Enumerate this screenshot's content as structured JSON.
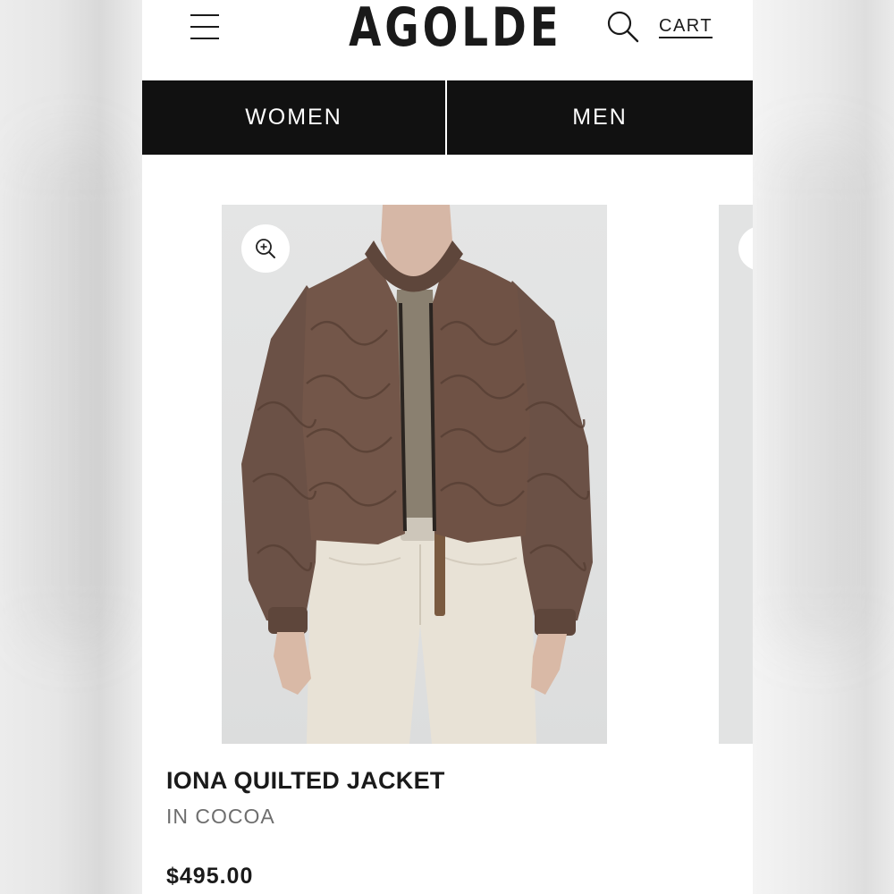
{
  "header": {
    "logo": "AGOLDE",
    "cart_label": "CART"
  },
  "nav": {
    "tabs": [
      {
        "label": "WOMEN"
      },
      {
        "label": "MEN"
      }
    ]
  },
  "product": {
    "name": "IONA QUILTED JACKET",
    "color": "IN COCOA",
    "price": "$495.00",
    "image_icon": "zoom-in-icon"
  },
  "colors": {
    "nav_background": "#111111",
    "jacket": "#6b5146",
    "pants": "#e8e2d6"
  }
}
